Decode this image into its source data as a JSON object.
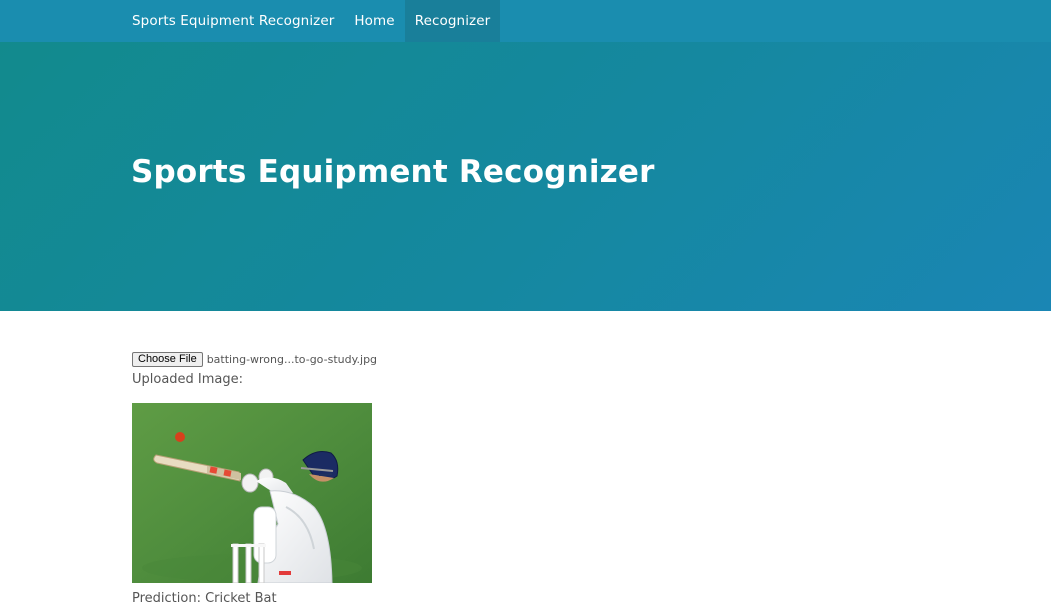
{
  "navbar": {
    "brand": "Sports Equipment Recognizer",
    "items": [
      {
        "label": "Home",
        "active": false
      },
      {
        "label": "Recognizer",
        "active": true
      }
    ]
  },
  "hero": {
    "title": "Sports Equipment Recognizer"
  },
  "upload": {
    "button_label": "Choose File",
    "file_name": "batting-wrong...to-go-study.jpg",
    "uploaded_label": "Uploaded Image:"
  },
  "result": {
    "prediction_text": "Prediction: Cricket Bat"
  },
  "colors": {
    "navbar": "#1a8daf",
    "nav_active": "#197f9a",
    "hero_start": "#128a8d",
    "hero_end": "#1a86b4",
    "text": "#555555"
  },
  "image": {
    "subject": "cricket batsman swinging bat at ball on grass field"
  }
}
